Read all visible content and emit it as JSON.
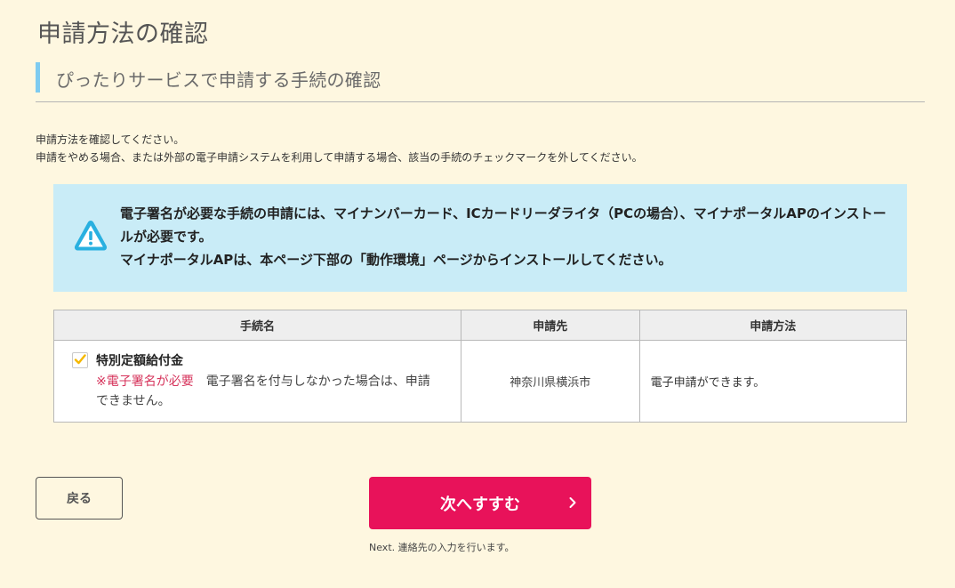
{
  "page": {
    "title": "申請方法の確認",
    "section_heading": "ぴったりサービスで申請する手続の確認"
  },
  "intro": {
    "line1": "申請方法を確認してください。",
    "line2": "申請をやめる場合、または外部の電子申請システムを利用して申請する場合、該当の手続のチェックマークを外してください。"
  },
  "notice": {
    "icon": "warning-icon",
    "line1": "電子署名が必要な手続の申請には、マイナンバーカード、ICカードリーダライタ（PCの場合）、マイナポータルAPのインストールが必要です。",
    "line2": "マイナポータルAPは、本ページ下部の「動作環境」ページからインストールしてください。"
  },
  "table": {
    "headers": {
      "procedure": "手続名",
      "destination": "申請先",
      "method": "申請方法"
    },
    "rows": [
      {
        "checked": true,
        "name": "特別定額給付金",
        "required_label": "※電子署名が必要",
        "note": "　電子署名を付与しなかった場合は、申請できません。",
        "destination": "神奈川県横浜市",
        "method": "電子申請ができます。"
      }
    ]
  },
  "buttons": {
    "back_label": "戻る",
    "next_label": "次へすすむ",
    "next_hint": "Next. 連絡先の入力を行います。"
  },
  "colors": {
    "background": "#fef7e0",
    "accent_bar": "#7ecbf0",
    "notice_bg": "#c9ecf7",
    "primary_button": "#e8125a",
    "required_text": "#d6335b",
    "checkbox_check": "#f5b800"
  }
}
